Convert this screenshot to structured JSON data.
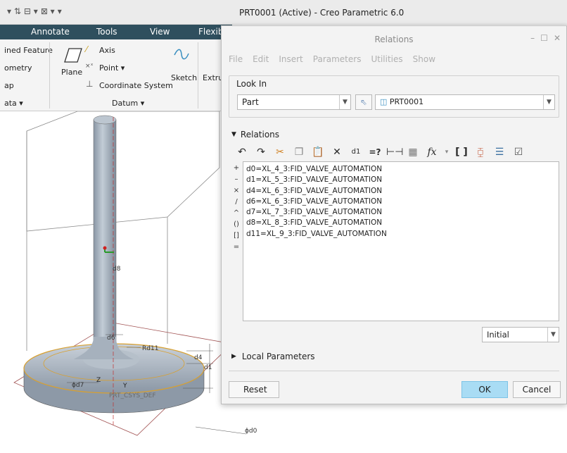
{
  "app_title": "PRT0001 (Active) - Creo Parametric 6.0",
  "ribbon": {
    "tabs": [
      "Annotate",
      "Tools",
      "View",
      "Flexib"
    ],
    "left_items": [
      "ined Feature",
      "ometry",
      "ap",
      "ata ▾"
    ],
    "plane": "Plane",
    "axis": "Axis",
    "point": "Point ▾",
    "coord_sys": "Coordinate System",
    "sketch": "Sketch",
    "extrude": "Extru",
    "datum_group": "Datum ▾"
  },
  "dialog": {
    "title": "Relations",
    "menu": [
      "File",
      "Edit",
      "Insert",
      "Parameters",
      "Utilities",
      "Show"
    ],
    "look_in_label": "Look In",
    "look_in_value": "Part",
    "model_name": "PRT0001",
    "relations_label": "Relations",
    "relations_lines": [
      "d0=XL_4_3:FID_VALVE_AUTOMATION",
      "d1=XL_5_3:FID_VALVE_AUTOMATION",
      "d4=XL_6_3:FID_VALVE_AUTOMATION",
      "d6=XL_6_3:FID_VALVE_AUTOMATION",
      "d7=XL_7_3:FID_VALVE_AUTOMATION",
      "d8=XL_8_3:FID_VALVE_AUTOMATION",
      "d11=XL_9_3:FID_VALVE_AUTOMATION"
    ],
    "side_ops": [
      "+",
      "–",
      "×",
      "/",
      "^",
      "()",
      "[]",
      "="
    ],
    "sort_value": "Initial",
    "local_parameters_label": "Local Parameters",
    "reset_label": "Reset",
    "ok_label": "OK",
    "cancel_label": "Cancel"
  },
  "model_labels": {
    "d8": "d8",
    "d6": "d6",
    "rd11": "Rd11",
    "d4": "d4",
    "d1": "d1",
    "d7": "ϕd7",
    "d0": "ϕd0",
    "csys": "PRT_CSYS_DEF",
    "z": "Z",
    "y": "Y"
  }
}
